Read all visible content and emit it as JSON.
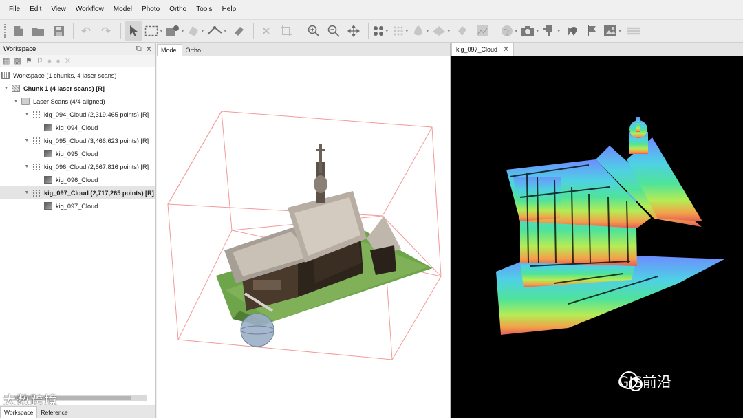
{
  "menubar": {
    "items": [
      {
        "label": "File"
      },
      {
        "label": "Edit"
      },
      {
        "label": "View"
      },
      {
        "label": "Workflow"
      },
      {
        "label": "Model"
      },
      {
        "label": "Photo"
      },
      {
        "label": "Ortho"
      },
      {
        "label": "Tools"
      },
      {
        "label": "Help"
      }
    ]
  },
  "toolbar": {
    "icons": [
      "new-icon",
      "open-icon",
      "save-icon",
      "undo-icon",
      "redo-icon",
      "navigation-icon",
      "rectangle-selection-icon",
      "tools-icon",
      "shape-icon",
      "ruler-icon",
      "eraser-icon",
      "delete-icon",
      "crop-icon",
      "zoom-in-icon",
      "zoom-out-icon",
      "move-object-icon",
      "show-points-icon",
      "show-cameras-icon",
      "shaded-model-icon",
      "solid-model-icon",
      "tiled-model-icon",
      "dem-icon",
      "globe-icon",
      "camera-icon",
      "laser-scan-icon",
      "markers-icon",
      "flag-icon",
      "image-icon",
      "layers-icon"
    ]
  },
  "workspace": {
    "title": "Workspace",
    "root": "Workspace (1 chunks, 4 laser scans)",
    "chunk": "Chunk 1 (4 laser scans) [R]",
    "folder": "Laser Scans (4/4 aligned)",
    "scans": [
      {
        "cloud": "kig_094_Cloud (2,319,465 points) [R]",
        "child": "kig_094_Cloud"
      },
      {
        "cloud": "kig_095_Cloud (3,466,623 points) [R]",
        "child": "kig_095_Cloud"
      },
      {
        "cloud": "kig_096_Cloud (2,667,816 points) [R]",
        "child": "kig_096_Cloud"
      },
      {
        "cloud": "kig_097_Cloud (2,717,265 points) [R]",
        "child": "kig_097_Cloud"
      }
    ],
    "bottom_tabs": [
      "Workspace",
      "Reference"
    ],
    "watermark": "大数跨境"
  },
  "model_view": {
    "tabs": [
      "Model",
      "Ortho"
    ]
  },
  "cloud_view": {
    "tab": "kig_097_Cloud"
  },
  "watermark_right": "GIS前沿"
}
